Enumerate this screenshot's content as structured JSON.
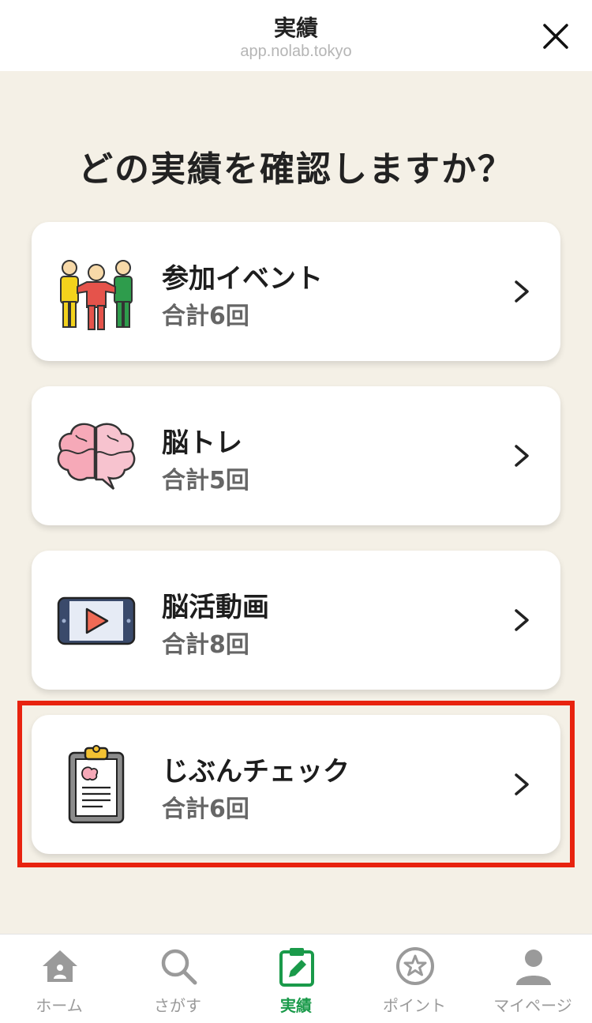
{
  "header": {
    "title": "実績",
    "url": "app.nolab.tokyo"
  },
  "main": {
    "heading": "どの実績を確認しますか？",
    "cards": [
      {
        "title": "参加イベント",
        "count": "合計6回",
        "icon": "people-icon"
      },
      {
        "title": "脳トレ",
        "count": "合計5回",
        "icon": "brain-puzzle-icon"
      },
      {
        "title": "脳活動画",
        "count": "合計8回",
        "icon": "video-play-icon"
      },
      {
        "title": "じぶんチェック",
        "count": "合計6回",
        "icon": "clipboard-icon"
      }
    ]
  },
  "tabbar": {
    "items": [
      {
        "label": "ホーム",
        "icon": "home-icon"
      },
      {
        "label": "さがす",
        "icon": "search-icon"
      },
      {
        "label": "実績",
        "icon": "clipboard-pencil-icon",
        "active": true
      },
      {
        "label": "ポイント",
        "icon": "star-circle-icon"
      },
      {
        "label": "マイページ",
        "icon": "person-icon"
      }
    ]
  },
  "colors": {
    "background": "#f4f0e6",
    "accent_green": "#1a9a4a",
    "highlight_red": "#e8230f"
  }
}
